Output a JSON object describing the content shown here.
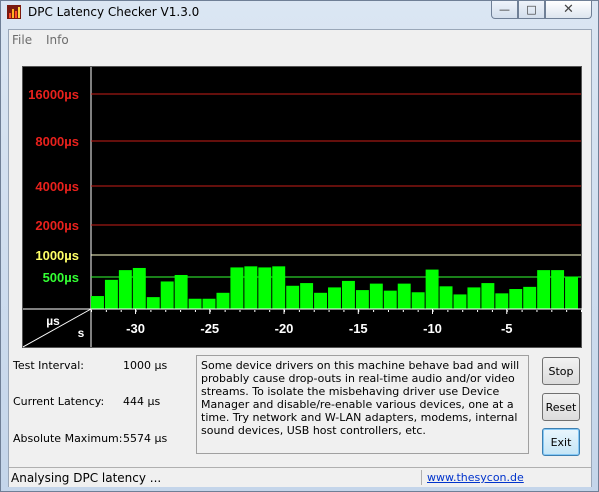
{
  "window": {
    "title": "DPC Latency Checker V1.3.0"
  },
  "menu": {
    "items": [
      "File",
      "Info"
    ]
  },
  "caption": {
    "minimize": "—",
    "maximize": "□",
    "close": "✕"
  },
  "chart_data": {
    "type": "bar",
    "title": "",
    "y_tick_labels": [
      {
        "label": "16000µs",
        "color": "#e8211c"
      },
      {
        "label": "8000µs",
        "color": "#e8211c"
      },
      {
        "label": "4000µs",
        "color": "#e8211c"
      },
      {
        "label": "2000µs",
        "color": "#e8211c"
      },
      {
        "label": "1000µs",
        "color": "#ffff66"
      },
      {
        "label": "500µs",
        "color": "#33ff33"
      }
    ],
    "y_unit_label": "µs",
    "x_unit_label": "s",
    "x_tick_labels": [
      "-30",
      "-25",
      "-20",
      "-15",
      "-10",
      "-5"
    ],
    "x_tick_values": [
      -30,
      -25,
      -20,
      -15,
      -10,
      -5
    ],
    "xlim": [
      -33,
      0
    ],
    "y_tick_values_us": [
      16000,
      8000,
      4000,
      2000,
      1000,
      500
    ],
    "values_us": [
      240,
      540,
      720,
      760,
      220,
      510,
      630,
      190,
      190,
      300,
      770,
      790,
      770,
      790,
      430,
      480,
      300,
      400,
      520,
      350,
      470,
      340,
      470,
      310,
      730,
      420,
      270,
      400,
      480,
      290,
      370,
      410,
      720,
      720,
      600
    ],
    "bar_color": "#00ff00",
    "background": "#000000"
  },
  "info": {
    "test_interval_label": "Test Interval:",
    "test_interval_value": "1000 µs",
    "current_latency_label": "Current Latency:",
    "current_latency_value": "444 µs",
    "absolute_maximum_label": "Absolute Maximum:",
    "absolute_maximum_value": "5574 µs",
    "message": "Some device drivers on this machine behave bad and will probably cause drop-outs in real-time audio and/or video streams. To isolate the misbehaving driver use Device Manager and disable/re-enable various devices, one at a time. Try network and W-LAN adapters, modems, internal sound devices, USB host controllers, etc."
  },
  "buttons": {
    "stop": "Stop",
    "reset": "Reset",
    "exit": "Exit"
  },
  "status": {
    "text": "Analysing DPC latency ...",
    "link": "www.thesycon.de"
  }
}
